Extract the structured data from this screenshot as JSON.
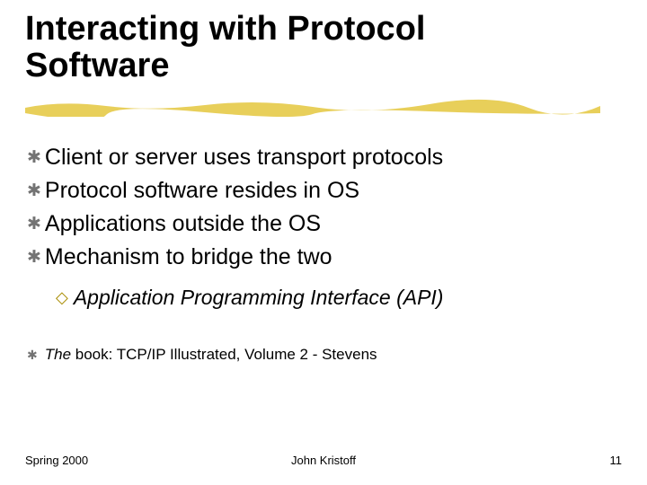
{
  "title_line1": "Interacting with Protocol",
  "title_line2": "Software",
  "bullets": {
    "b0": "Client or server uses transport protocols",
    "b1": "Protocol software resides in OS",
    "b2": "Applications outside the OS",
    "b3": "Mechanism to bridge the two"
  },
  "sub": "Application Programming Interface (API)",
  "book_the": "The",
  "book_rest": " book: TCP/IP Illustrated, Volume 2 - Stevens",
  "footer": {
    "left": "Spring 2000",
    "center": "John Kristoff",
    "right": "11"
  },
  "glyphs": {
    "z": "✱",
    "y": "◇"
  }
}
